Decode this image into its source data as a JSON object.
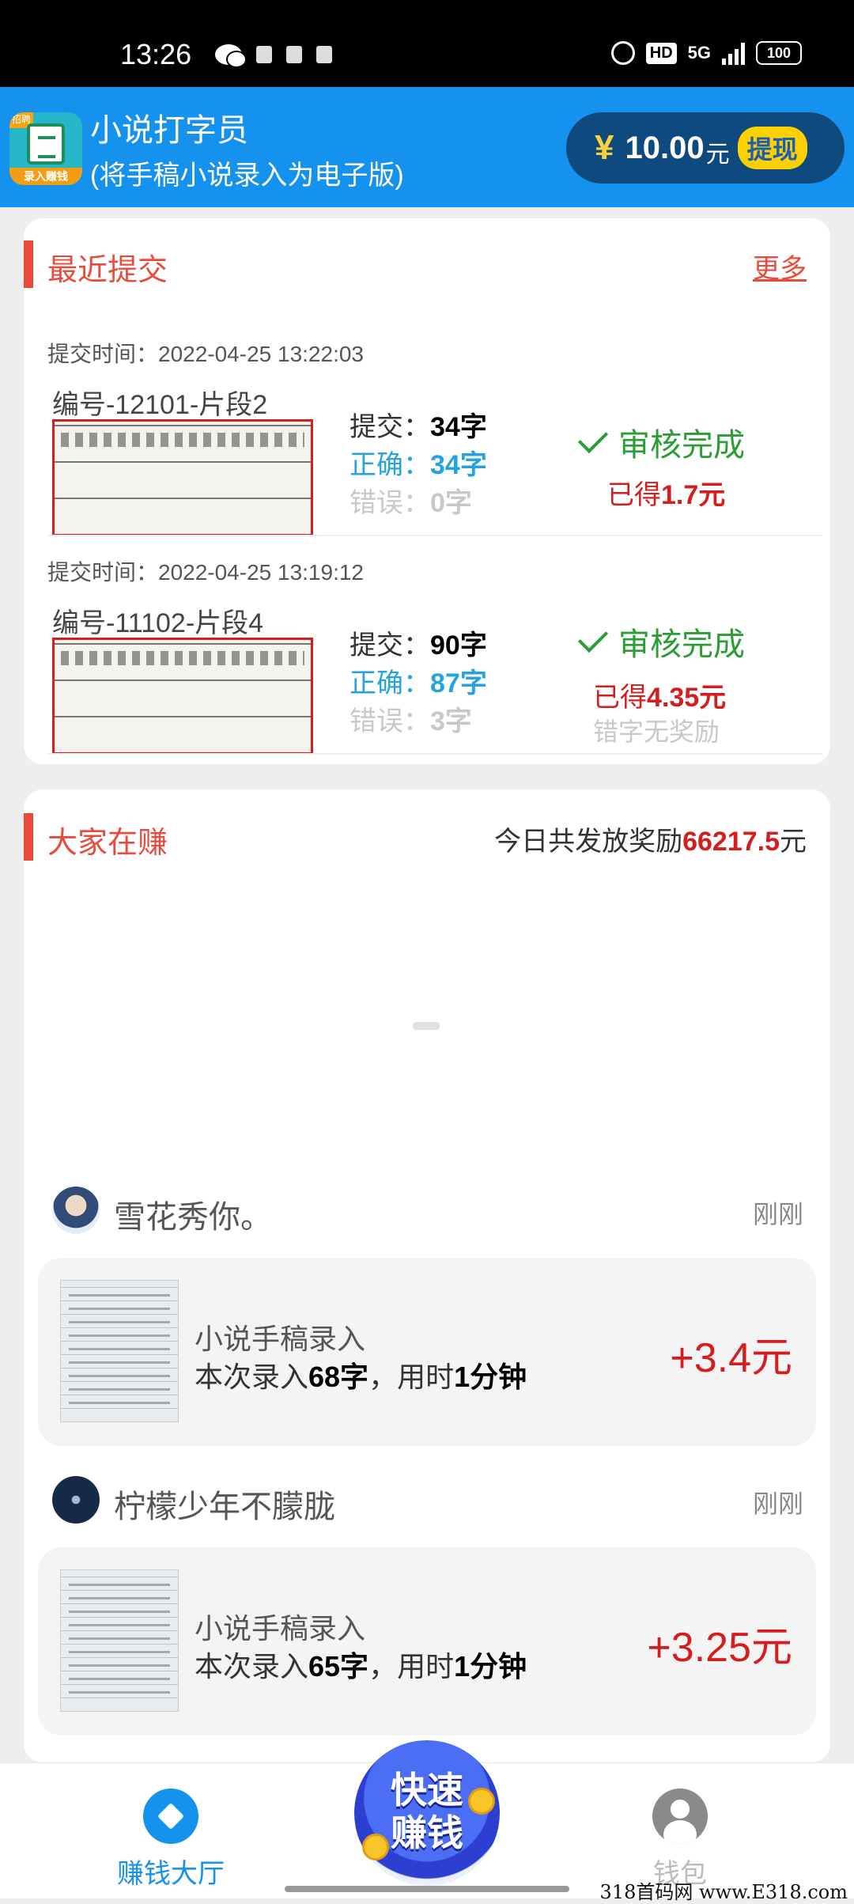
{
  "status_bar": {
    "time": "13:26",
    "hd": "HD",
    "network": "5G",
    "battery": "100"
  },
  "header": {
    "app_badge": "招聘",
    "app_icon_text": "录入赚钱",
    "title": "小说打字员",
    "subtitle": "(将手稿小说录入为电子版)",
    "currency_symbol": "¥",
    "balance": "10.00",
    "balance_unit": "元",
    "withdraw_label": "提现"
  },
  "recent": {
    "title": "最近提交",
    "more_label": "更多",
    "submissions": [
      {
        "time": "提交时间：2022-04-25 13:22:03",
        "segment": "编号-12101-片段2",
        "submit_label": "提交：",
        "submit_value": "34字",
        "correct_label": "正确：",
        "correct_value": "34字",
        "error_label": "错误：",
        "error_value": "0字",
        "status": "审核完成",
        "earned_label": "已得",
        "earned_value": "1.7元",
        "note": ""
      },
      {
        "time": "提交时间：2022-04-25 13:19:12",
        "segment": "编号-11102-片段4",
        "submit_label": "提交：",
        "submit_value": "90字",
        "correct_label": "正确：",
        "correct_value": "87字",
        "error_label": "错误：",
        "error_value": "3字",
        "status": "审核完成",
        "earned_label": "已得",
        "earned_value": "4.35元",
        "note": "错字无奖励"
      }
    ]
  },
  "earning": {
    "title": "大家在赚",
    "today_prefix": "今日共发放奖励",
    "today_amount": "66217.5",
    "today_unit": "元",
    "feed": [
      {
        "user": "雪花秀你。",
        "time": "刚刚",
        "task": "小说手稿录入",
        "detail_prefix": "本次录入",
        "chars": "68字",
        "detail_mid": "，用时",
        "duration": "1分钟",
        "amount": "+3.4元"
      },
      {
        "user": "柠檬少年不朦胧",
        "time": "刚刚",
        "task": "小说手稿录入",
        "detail_prefix": "本次录入",
        "chars": "65字",
        "detail_mid": "，用时",
        "duration": "1分钟",
        "amount": "+3.25元"
      }
    ]
  },
  "bottom_nav": {
    "hall_label": "赚钱大厅",
    "fab_line1": "快速",
    "fab_line2": "赚钱",
    "wallet_label": "钱包"
  },
  "watermark": "318首码网 www.E318.com",
  "colors": {
    "primary": "#1591ee",
    "accent_red": "#d51d1d",
    "section_red": "#e84b3c",
    "success_green": "#2a9d35",
    "correct_blue": "#25a2e0"
  }
}
